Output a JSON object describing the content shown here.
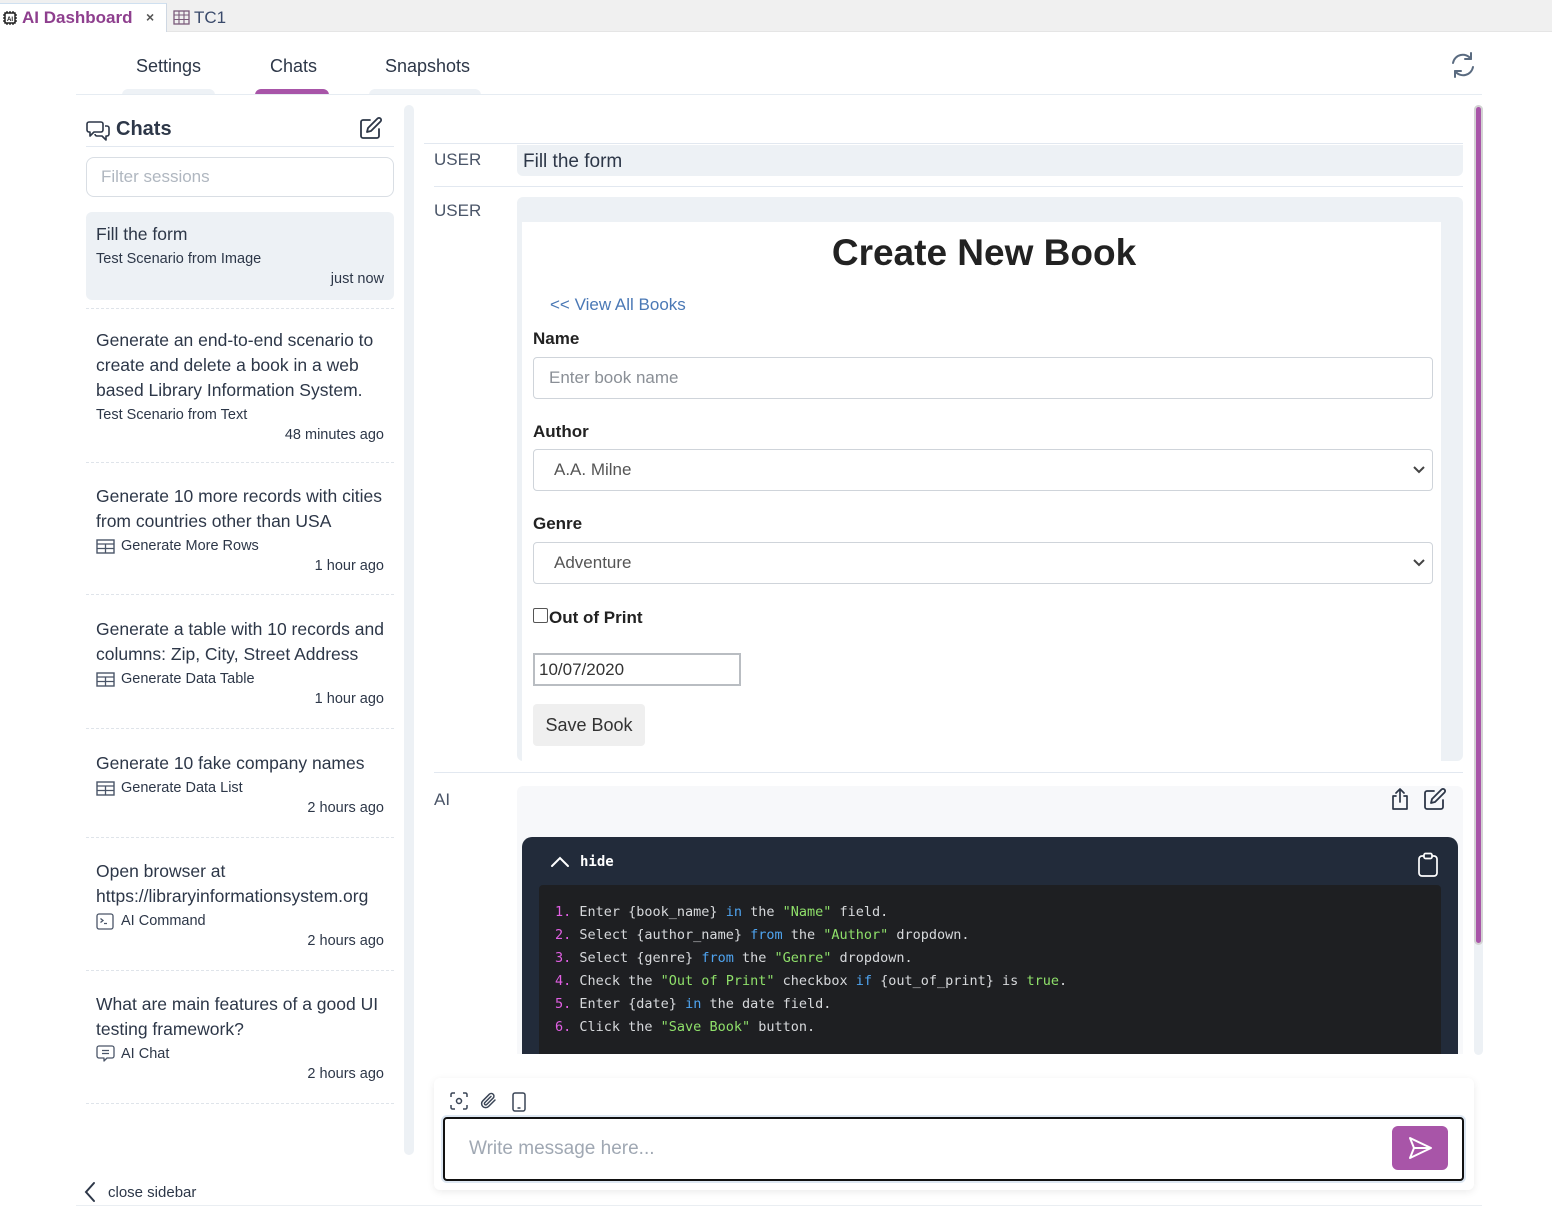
{
  "editor_tabs": [
    {
      "label": "AI Dashboard",
      "icon": "ai-chip-icon",
      "active": true,
      "close_glyph": "×"
    },
    {
      "label": "TC1",
      "icon": "table-icon",
      "active": false
    }
  ],
  "nav": {
    "tabs": [
      {
        "label": "Settings",
        "active": false
      },
      {
        "label": "Chats",
        "active": true
      },
      {
        "label": "Snapshots",
        "active": false
      }
    ],
    "refresh_icon": "refresh-icon"
  },
  "colors": {
    "accent": "#a855a8",
    "tab_active_text": "#8e3f8e",
    "code_bg": "#222b3a",
    "panel_bg": "#edf1f5"
  },
  "sidebar": {
    "title": "Chats",
    "filter_placeholder": "Filter sessions",
    "filter_value": "",
    "sessions": [
      {
        "title": "Fill the form",
        "type": "Test Scenario from Image",
        "type_icon": "",
        "time": "just now",
        "selected": true
      },
      {
        "title": "Generate an end-to-end scenario to create and delete a book in a web based Library Information System.",
        "type": "Test Scenario from Text",
        "type_icon": "",
        "time": "48 minutes ago",
        "selected": false
      },
      {
        "title": "Generate 10 more records with cities from countries other than USA",
        "type": "Generate More Rows",
        "type_icon": "table-icon",
        "time": "1 hour ago",
        "selected": false
      },
      {
        "title": "Generate a table with 10 records and columns: Zip, City, Street Address",
        "type": "Generate Data Table",
        "type_icon": "table-icon",
        "time": "1 hour ago",
        "selected": false
      },
      {
        "title": "Generate 10 fake company names",
        "type": "Generate Data List",
        "type_icon": "table-icon",
        "time": "2 hours ago",
        "selected": false
      },
      {
        "title": "Open browser at https://libraryinformationsystem.org",
        "type": "AI Command",
        "type_icon": "terminal-icon",
        "time": "2 hours ago",
        "selected": false
      },
      {
        "title": "What are main features of a good UI testing framework?",
        "type": "AI Chat",
        "type_icon": "chat-icon",
        "time": "2 hours ago",
        "selected": false
      }
    ],
    "close_label": "close sidebar"
  },
  "chat": {
    "messages": [
      {
        "role": "USER",
        "text": "Fill the form"
      },
      {
        "role": "USER",
        "attachment": {
          "heading": "Create New Book",
          "back_link": "<< View All Books",
          "name_label": "Name",
          "name_placeholder": "Enter book name",
          "author_label": "Author",
          "author_value": "A.A. Milne",
          "genre_label": "Genre",
          "genre_value": "Adventure",
          "out_of_print_label": "Out of Print",
          "out_of_print_checked": false,
          "date_value": "10/07/2020",
          "save_label": "Save Book"
        }
      },
      {
        "role": "AI",
        "toggle_label": "hide",
        "steps": [
          [
            {
              "t": "n",
              "v": "1."
            },
            {
              "t": "p",
              "v": " Enter {book_name} "
            },
            {
              "t": "kw",
              "v": "in"
            },
            {
              "t": "p",
              "v": " the "
            },
            {
              "t": "st",
              "v": "\"Name\""
            },
            {
              "t": "p",
              "v": " field."
            }
          ],
          [
            {
              "t": "n",
              "v": "2."
            },
            {
              "t": "p",
              "v": " Select {author_name} "
            },
            {
              "t": "kw",
              "v": "from"
            },
            {
              "t": "p",
              "v": " the "
            },
            {
              "t": "st",
              "v": "\"Author\""
            },
            {
              "t": "p",
              "v": " dropdown."
            }
          ],
          [
            {
              "t": "n",
              "v": "3."
            },
            {
              "t": "p",
              "v": " Select {genre} "
            },
            {
              "t": "kw",
              "v": "from"
            },
            {
              "t": "p",
              "v": " the "
            },
            {
              "t": "st",
              "v": "\"Genre\""
            },
            {
              "t": "p",
              "v": " dropdown."
            }
          ],
          [
            {
              "t": "n",
              "v": "4."
            },
            {
              "t": "p",
              "v": " Check the "
            },
            {
              "t": "st",
              "v": "\"Out of Print\""
            },
            {
              "t": "p",
              "v": " checkbox "
            },
            {
              "t": "kw",
              "v": "if"
            },
            {
              "t": "p",
              "v": " {out_of_print} is "
            },
            {
              "t": "st",
              "v": "true"
            },
            {
              "t": "p",
              "v": "."
            }
          ],
          [
            {
              "t": "n",
              "v": "5."
            },
            {
              "t": "p",
              "v": " Enter {date} "
            },
            {
              "t": "kw",
              "v": "in"
            },
            {
              "t": "p",
              "v": " the date field."
            }
          ],
          [
            {
              "t": "n",
              "v": "6."
            },
            {
              "t": "p",
              "v": " Click the "
            },
            {
              "t": "st",
              "v": "\"Save Book\""
            },
            {
              "t": "p",
              "v": " button."
            }
          ]
        ]
      }
    ]
  },
  "composer": {
    "placeholder": "Write message here...",
    "value": "",
    "tools": [
      "screenshot-icon",
      "paperclip-icon",
      "mobile-icon"
    ],
    "send_icon": "send-icon"
  }
}
